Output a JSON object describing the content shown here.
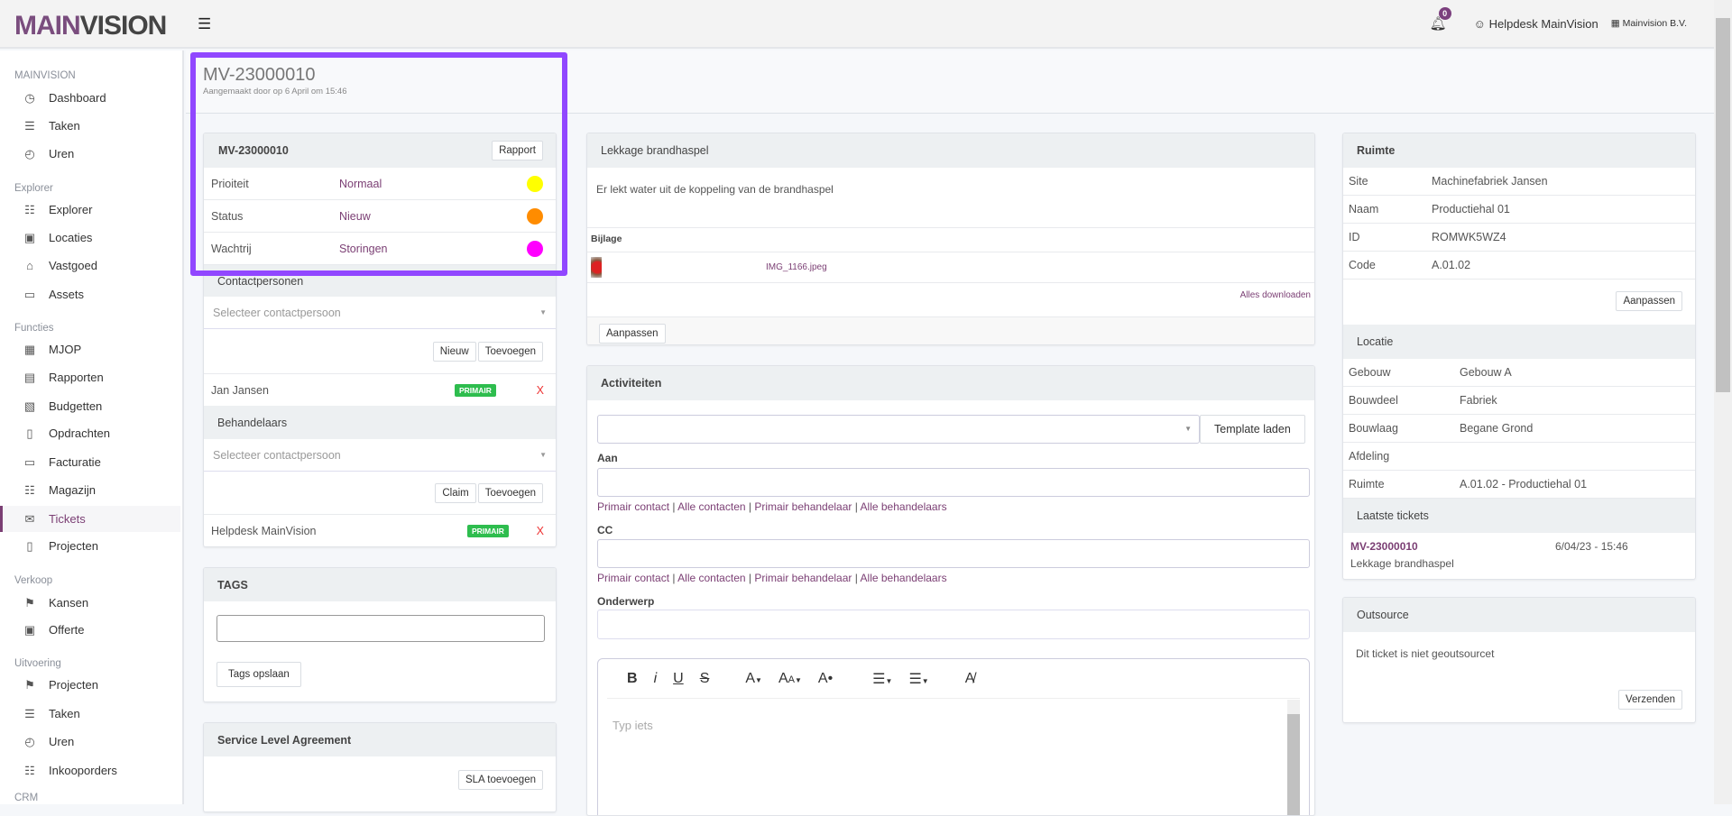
{
  "header": {
    "logo_main": "MAIN",
    "logo_accent": "VISION",
    "notifications": "0",
    "user": "Helpdesk MainVision",
    "company": "Mainvision B.V."
  },
  "sidebar": {
    "sections": [
      {
        "label": "MAINVISION",
        "items": [
          {
            "label": "Dashboard",
            "icon": "dashboard-icon"
          },
          {
            "label": "Taken",
            "icon": "list-icon"
          },
          {
            "label": "Uren",
            "icon": "clock-icon"
          }
        ]
      },
      {
        "label": "Explorer",
        "items": [
          {
            "label": "Explorer",
            "icon": "sitemap-icon"
          },
          {
            "label": "Locaties",
            "icon": "briefcase-icon"
          },
          {
            "label": "Vastgoed",
            "icon": "home-icon"
          },
          {
            "label": "Assets",
            "icon": "folder-icon"
          }
        ]
      },
      {
        "label": "Functies",
        "items": [
          {
            "label": "MJOP",
            "icon": "calendar-icon"
          },
          {
            "label": "Rapporten",
            "icon": "book-icon"
          },
          {
            "label": "Budgetten",
            "icon": "calculator-icon"
          },
          {
            "label": "Opdrachten",
            "icon": "file-icon"
          },
          {
            "label": "Facturatie",
            "icon": "folder-icon"
          },
          {
            "label": "Magazijn",
            "icon": "grid-icon"
          },
          {
            "label": "Tickets",
            "icon": "envelope-icon"
          },
          {
            "label": "Projecten",
            "icon": "book-open-icon"
          }
        ]
      },
      {
        "label": "Verkoop",
        "items": [
          {
            "label": "Kansen",
            "icon": "signpost-icon"
          },
          {
            "label": "Offerte",
            "icon": "briefcase-icon"
          }
        ]
      },
      {
        "label": "Uitvoering",
        "items": [
          {
            "label": "Projecten",
            "icon": "signpost-icon"
          },
          {
            "label": "Taken",
            "icon": "list-icon"
          },
          {
            "label": "Uren",
            "icon": "clock-icon"
          },
          {
            "label": "Inkooporders",
            "icon": "grid-icon"
          }
        ]
      },
      {
        "label": "CRM",
        "items": []
      }
    ]
  },
  "page": {
    "title": "MV-23000010",
    "subtitle": "Aangemaakt door op 6 April om 15:46"
  },
  "ticket": {
    "id": "MV-23000010",
    "report_button": "Rapport",
    "rows": [
      {
        "label": "Prioiteit",
        "value": "Normaal",
        "color": "#ffff00"
      },
      {
        "label": "Status",
        "value": "Nieuw",
        "color": "#ff8c00"
      },
      {
        "label": "Wachtrij",
        "value": "Storingen",
        "color": "#ff00ff"
      }
    ]
  },
  "contacts": {
    "title": "Contactpersonen",
    "placeholder": "Selecteer contactpersoon",
    "new_button": "Nieuw",
    "add_button": "Toevoegen",
    "people": [
      {
        "name": "Jan Jansen",
        "badge": "PRIMAIR",
        "remove": "X"
      }
    ]
  },
  "handlers": {
    "title": "Behandelaars",
    "placeholder": "Selecteer contactpersoon",
    "claim_button": "Claim",
    "add_button": "Toevoegen",
    "people": [
      {
        "name": "Helpdesk MainVision",
        "badge": "PRIMAIR",
        "remove": "X"
      }
    ]
  },
  "tags": {
    "title": "TAGS",
    "value": "",
    "save_button": "Tags opslaan"
  },
  "sla": {
    "title": "Service Level Agreement",
    "add_button": "SLA toevoegen"
  },
  "issue": {
    "title": "Lekkage brandhaspel",
    "description": "Er lekt water uit de koppeling van de brandhaspel",
    "attachment_label": "Bijlage",
    "file": "IMG_1166.jpeg",
    "download_all": "Alles downloaden",
    "edit_button": "Aanpassen"
  },
  "activities": {
    "title": "Activiteiten",
    "template_button": "Template laden",
    "to_label": "Aan",
    "cc_label": "CC",
    "subject_label": "Onderwerp",
    "quick_links": [
      "Primair contact",
      "Alle contacten",
      "Primair behandelaar",
      "Alle behandelaars"
    ],
    "editor_placeholder": "Typ iets"
  },
  "room": {
    "title": "Ruimte",
    "rows": [
      {
        "k": "Site",
        "v": "Machinefabriek Jansen"
      },
      {
        "k": "Naam",
        "v": "Productiehal 01"
      },
      {
        "k": "ID",
        "v": "ROMWK5WZ4"
      },
      {
        "k": "Code",
        "v": "A.01.02"
      }
    ],
    "edit_button": "Aanpassen"
  },
  "location": {
    "title": "Locatie",
    "rows": [
      {
        "k": "Gebouw",
        "v": "Gebouw A"
      },
      {
        "k": "Bouwdeel",
        "v": "Fabriek"
      },
      {
        "k": "Bouwlaag",
        "v": "Begane Grond"
      },
      {
        "k": "Afdeling",
        "v": ""
      },
      {
        "k": "Ruimte",
        "v": "A.01.02 - Productiehal 01"
      }
    ]
  },
  "recent": {
    "title": "Laatste tickets",
    "items": [
      {
        "id": "MV-23000010",
        "date": "6/04/23 - 15:46",
        "title": "Lekkage brandhaspel"
      }
    ]
  },
  "outsource": {
    "title": "Outsource",
    "text": "Dit ticket is niet geoutsourcet",
    "send_button": "Verzenden"
  }
}
